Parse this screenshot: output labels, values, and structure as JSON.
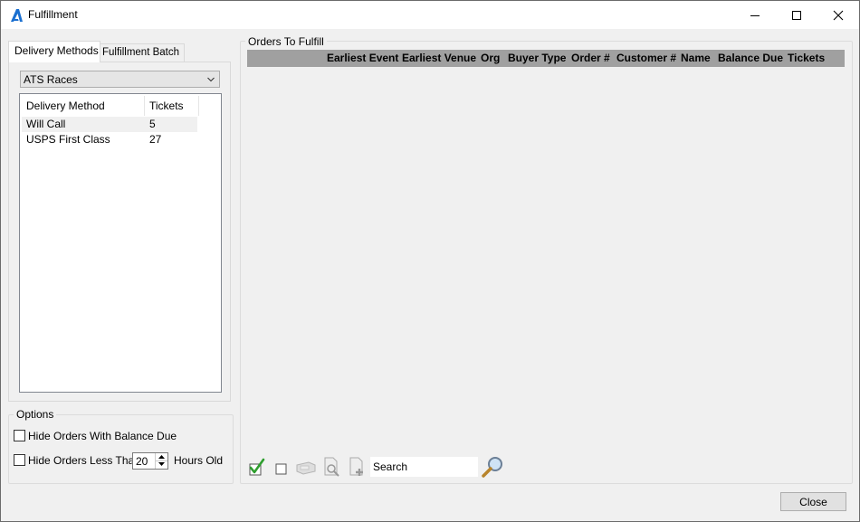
{
  "window": {
    "title": "Fulfillment"
  },
  "left_tabs": [
    {
      "label": "Delivery Methods"
    },
    {
      "label": "Fulfillment Batch"
    }
  ],
  "organization_select": {
    "value": "ATS Races"
  },
  "delivery_list": {
    "columns": [
      "Delivery Method",
      "Tickets"
    ],
    "rows": [
      {
        "method": "Will Call",
        "tickets": "5"
      },
      {
        "method": "USPS First Class",
        "tickets": "27"
      }
    ]
  },
  "options": {
    "title": "Options",
    "hide_balance_label": "Hide Orders With Balance Due",
    "hide_hours_prefix": "Hide Orders Less Than",
    "hours_value": "20",
    "hide_hours_suffix": "Hours Old"
  },
  "orders": {
    "title": "Orders To Fulfill",
    "columns": [
      "Earliest Event",
      "Earliest Venue",
      "Org",
      "Buyer Type",
      "Order #",
      "Customer #",
      "Name",
      "Balance Due",
      "Tickets"
    ]
  },
  "toolbar": {
    "search_value": "Search"
  },
  "footer": {
    "close_label": "Close"
  },
  "colors": {
    "accent": "#1a6fd0",
    "grid_header": "#a0a0a0"
  }
}
